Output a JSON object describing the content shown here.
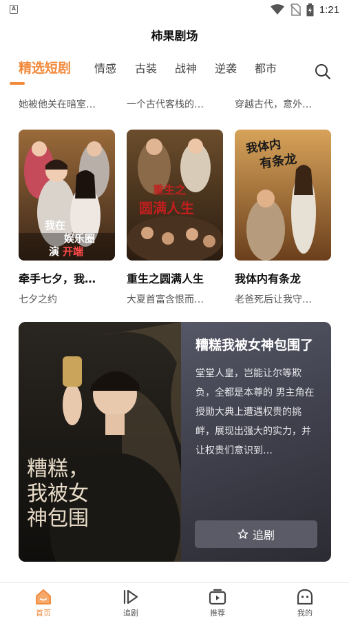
{
  "status_bar": {
    "time": "1:21"
  },
  "app": {
    "title": "柿果剧场"
  },
  "tabs": [
    {
      "label": "精选短剧",
      "active": true
    },
    {
      "label": "情感"
    },
    {
      "label": "古装"
    },
    {
      "label": "战神"
    },
    {
      "label": "逆袭"
    },
    {
      "label": "都市"
    }
  ],
  "prev_row": [
    {
      "desc": "她被他关在暗室…"
    },
    {
      "desc": "一个古代客栈的…"
    },
    {
      "desc": "穿越古代，意外…"
    }
  ],
  "cards": [
    {
      "title": "牵手七夕，我…",
      "subtitle": "七夕之约",
      "poster_text_1": "我在",
      "poster_text_2": "娱乐圈",
      "poster_text_3": "演",
      "poster_text_4": "开端"
    },
    {
      "title": "重生之圆满人生",
      "subtitle": "大夏首富含恨而…",
      "poster_text_1": "重生之",
      "poster_text_2": "圆满人生"
    },
    {
      "title": "我体内有条龙",
      "subtitle": "老爸死后让我守…",
      "poster_text_1": "我体内",
      "poster_text_2": "有条龙"
    }
  ],
  "featured": {
    "title": "糟糕我被女神包围了",
    "description": "堂堂人皇，岂能让尔等欺负，全都是本尊的 男主角在授勋大典上遭遇权贵的挑衅，展现出强大的实力，并让权贵们意识到…",
    "button_label": "追剧",
    "poster_text": "糟糕，我被女神包围"
  },
  "bottom_nav": [
    {
      "label": "首页",
      "icon": "home-icon",
      "active": true
    },
    {
      "label": "追剧",
      "icon": "play-icon"
    },
    {
      "label": "推荐",
      "icon": "tv-icon"
    },
    {
      "label": "我的",
      "icon": "profile-icon"
    }
  ],
  "colors": {
    "accent": "#f28a3c",
    "featured_bg": "#4a4b57"
  }
}
